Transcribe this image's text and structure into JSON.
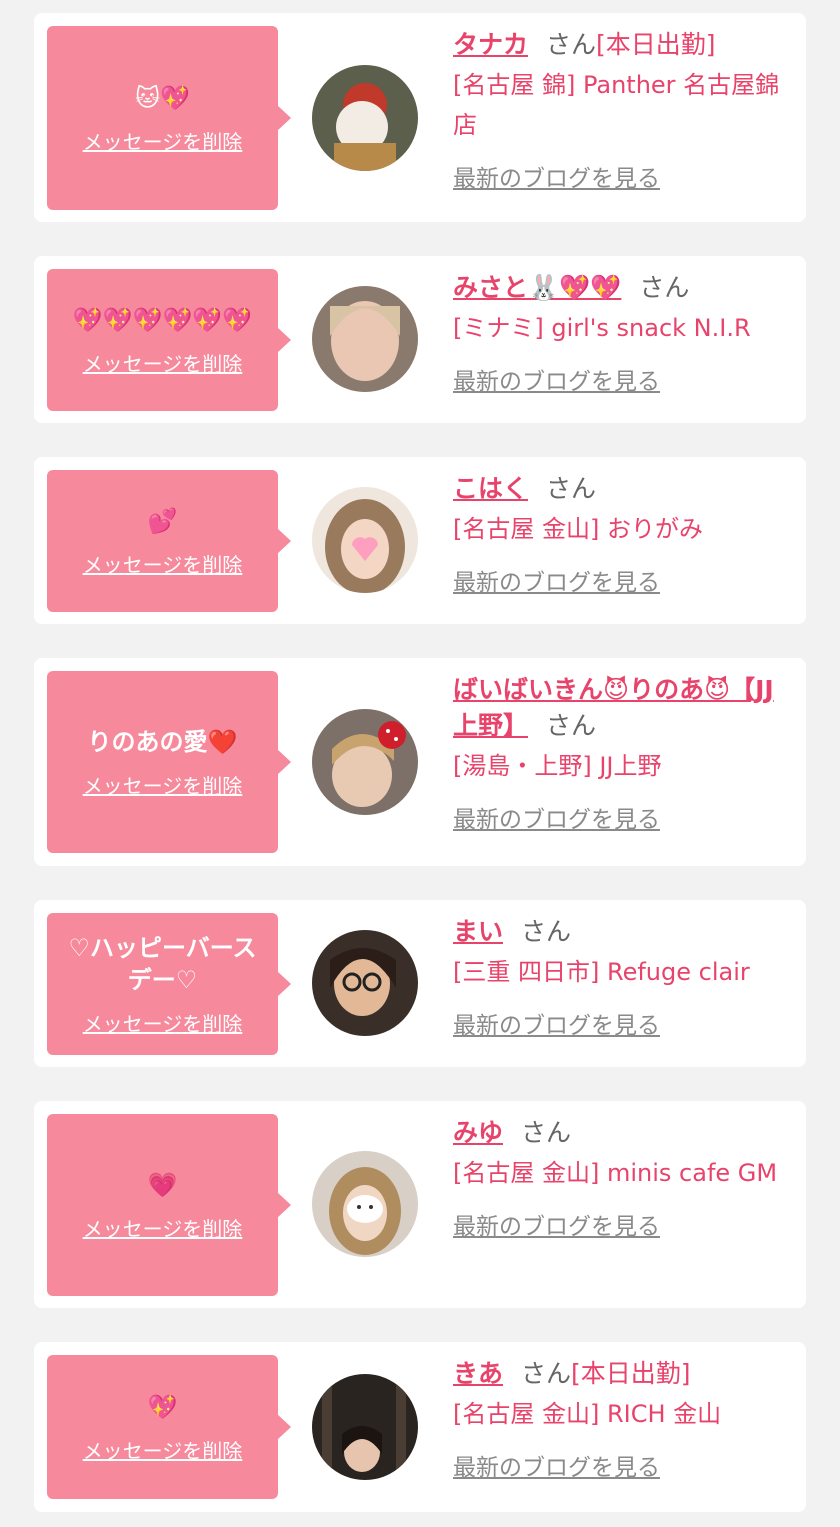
{
  "delete_label": "メッセージを削除",
  "san_label": "さん",
  "blog_label": "最新のブログを見る",
  "colors": {
    "accent": "#e8436b",
    "bubble": "#f6899b",
    "background": "#f2f2f2"
  },
  "entries": [
    {
      "message": "🐱💖",
      "name": "タナカ",
      "duty": "[本日出勤]",
      "shop": "[名古屋 錦] Panther 名古屋錦店"
    },
    {
      "message": "💖💖💖💖💖💖",
      "name": "みさと🐰💖💖",
      "duty": "",
      "shop": "[ミナミ] girl's snack N.I.R"
    },
    {
      "message": "💕",
      "name": "こはく",
      "duty": "",
      "shop": "[名古屋 金山] おりがみ"
    },
    {
      "message": "りのあの愛❤️",
      "name": "ばいばいきん😈りのあ😈【JJ上野】",
      "duty": "",
      "shop": "[湯島・上野] JJ上野"
    },
    {
      "message": "♡ハッピーバースデー♡",
      "name": "まい",
      "duty": "",
      "shop": "[三重 四日市] Refuge clair"
    },
    {
      "message": "💗",
      "name": "みゆ",
      "duty": "",
      "shop": "[名古屋 金山] minis cafe GM"
    },
    {
      "message": "💖",
      "name": "きあ",
      "duty": "[本日出勤]",
      "shop": "[名古屋 金山] RICH 金山"
    }
  ]
}
